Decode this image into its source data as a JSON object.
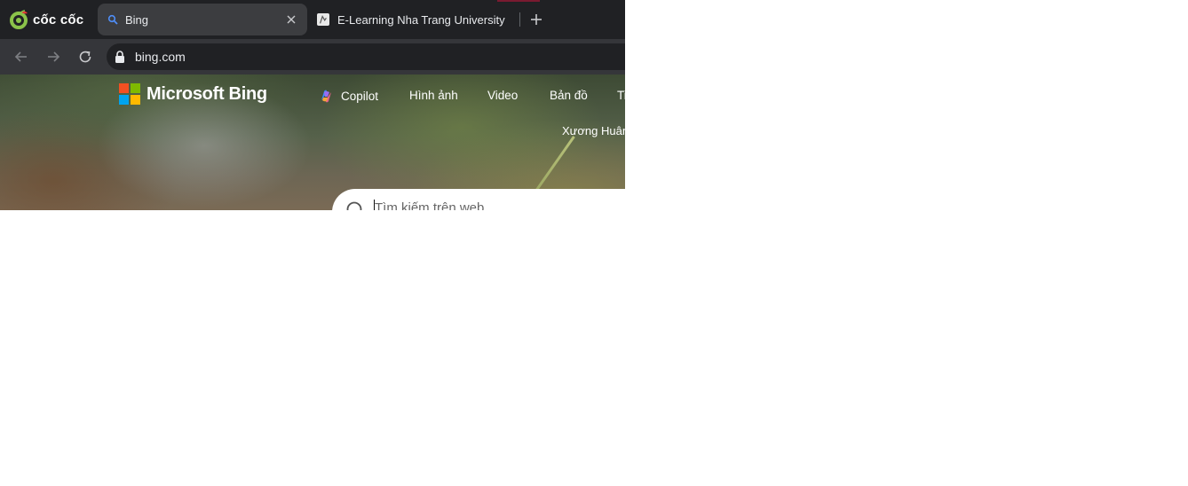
{
  "browser": {
    "brand": "cốc cốc",
    "tabs": [
      {
        "title": "Bing",
        "favicon": "search-icon",
        "active": true
      },
      {
        "title": "E-Learning Nha Trang University",
        "favicon": "site-favicon",
        "active": false
      }
    ],
    "address_bar": {
      "url": "bing.com"
    }
  },
  "bing": {
    "logo_text": "Microsoft Bing",
    "nav": {
      "copilot": "Copilot",
      "images": "Hình ảnh",
      "video": "Video",
      "maps": "Bản đồ",
      "more_partial": "Ti"
    },
    "user_name": "Xương Huân",
    "search": {
      "placeholder": "Tìm kiếm trên web"
    }
  },
  "colors": {
    "tab_strip": "#202124",
    "active_tab": "#3c3d40",
    "toolbar": "#35363a",
    "ms_red": "#f25022",
    "ms_green": "#7fba00",
    "ms_blue": "#00a4ef",
    "ms_yellow": "#ffb900"
  }
}
